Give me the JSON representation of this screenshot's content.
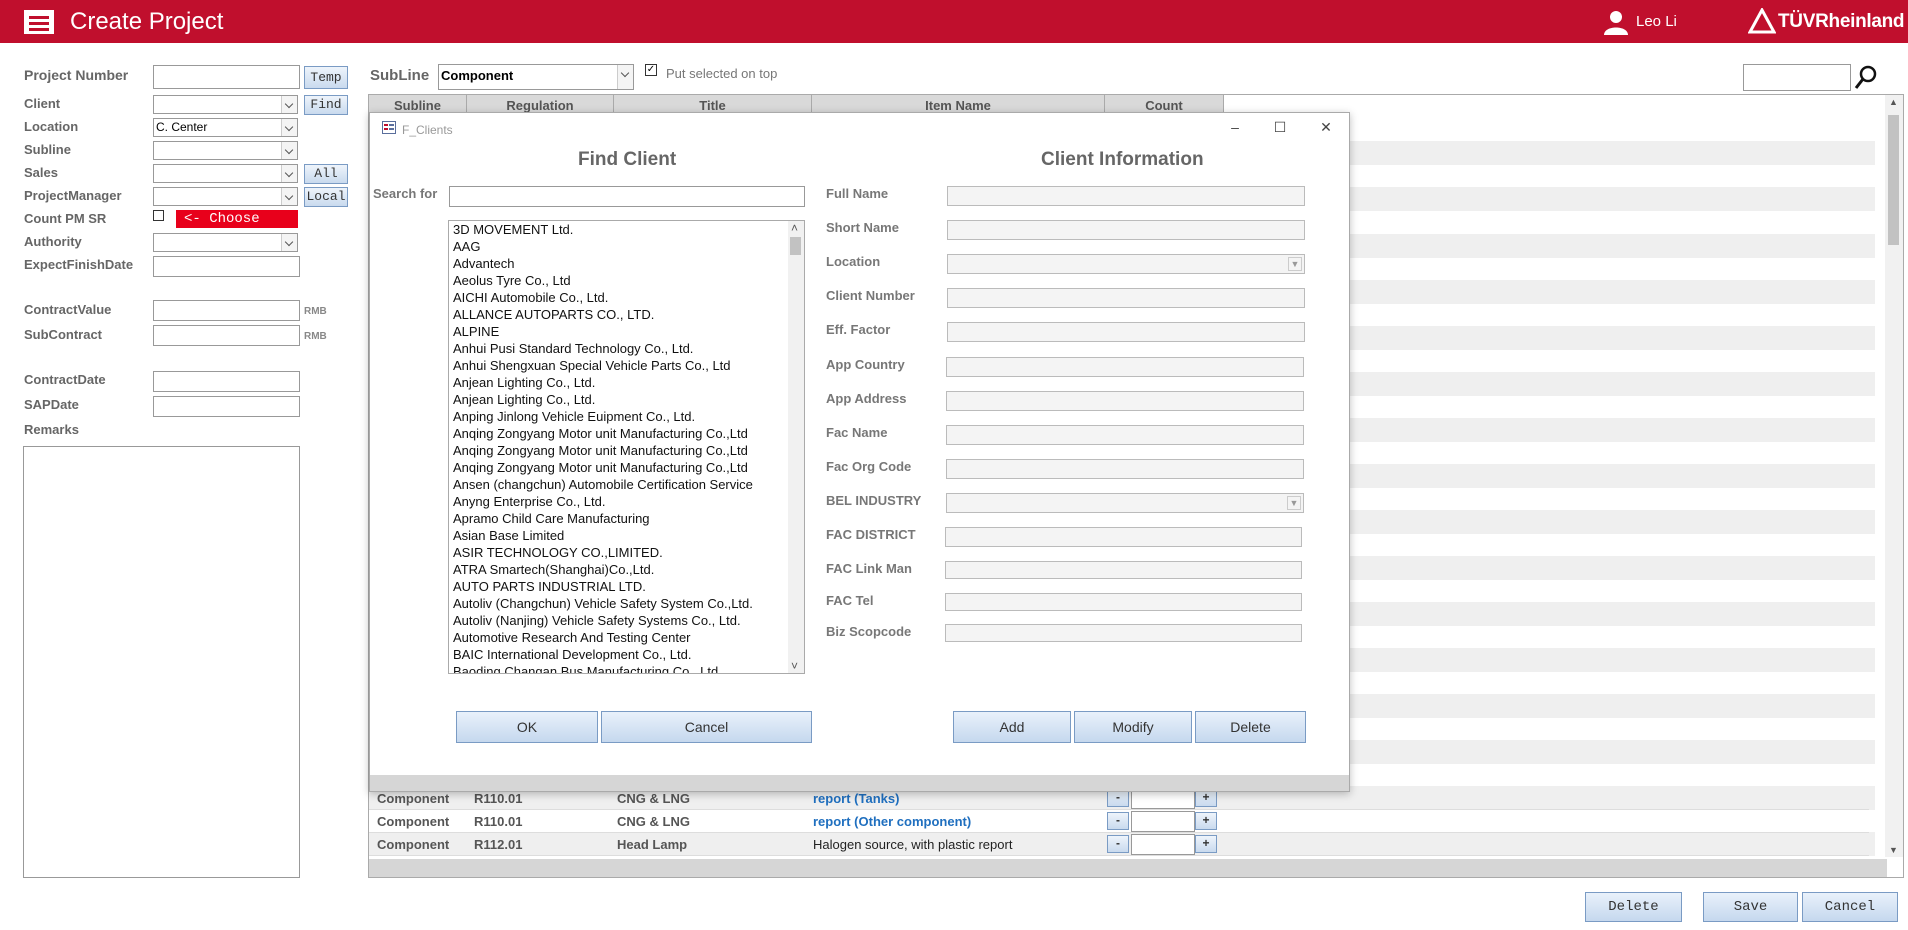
{
  "header": {
    "title": "Create Project",
    "user_name": "Leo Li",
    "brand": "TÜVRheinland",
    "brand_color": "#c00f2d"
  },
  "form": {
    "project_number_label": "Project Number",
    "temp_button": "Temp",
    "client_label": "Client",
    "find_button": "Find",
    "location_label": "Location",
    "location_value": "C. Center",
    "subline_label": "Subline",
    "sales_label": "Sales",
    "all_button": "All",
    "pm_label": "ProjectManager",
    "local_button": "Local",
    "count_pm_sr_label": "Count PM SR",
    "choose_tag": "<- Choose",
    "authority_label": "Authority",
    "expect_finish_label": "ExpectFinishDate",
    "contract_value_label": "ContractValue",
    "rmb_1": "RMB",
    "subcontract_label": "SubContract",
    "rmb_2": "RMB",
    "contract_date_label": "ContractDate",
    "sap_date_label": "SAPDate",
    "remarks_label": "Remarks"
  },
  "toolbar": {
    "subline_label": "SubLine",
    "subline_value": "Component",
    "put_on_top_label": "Put selected on top",
    "put_on_top_checked": true,
    "search_icon": "search-icon"
  },
  "grid": {
    "columns": [
      "Subline",
      "Regulation",
      "Title",
      "Item Name",
      "Count"
    ],
    "rows": [
      {
        "subline": "Component",
        "regulation": "R110.01",
        "title": "CNG & LNG",
        "item": "report (Tanks)",
        "item_color": "#1f6fbf"
      },
      {
        "subline": "Component",
        "regulation": "R110.01",
        "title": "CNG & LNG",
        "item": "report (Other component)",
        "item_color": "#1f6fbf"
      },
      {
        "subline": "Component",
        "regulation": "R112.01",
        "title": "Head Lamp",
        "item": "Halogen source, with plastic report",
        "item_color": "#222222"
      }
    ],
    "minus": "-",
    "plus": "+"
  },
  "dialog": {
    "window_title": "F_Clients",
    "find_heading": "Find Client",
    "info_heading": "Client Information",
    "search_for_label": "Search for",
    "clients": [
      "3D MOVEMENT Ltd.",
      "AAG",
      "Advantech",
      "Aeolus Tyre Co., Ltd",
      "AICHI Automobile Co., Ltd.",
      "ALLANCE AUTOPARTS CO., LTD.",
      "ALPINE",
      "Anhui Pusi Standard Technology Co., Ltd.",
      "Anhui Shengxuan Special Vehicle Parts Co., Ltd",
      "Anjean Lighting Co., Ltd.",
      "Anjean Lighting Co., Ltd.",
      "Anping Jinlong Vehicle Euipment Co., Ltd.",
      "Anqing Zongyang Motor unit Manufacturing Co.,Ltd",
      "Anqing Zongyang Motor unit Manufacturing Co.,Ltd",
      "Anqing Zongyang Motor unit Manufacturing Co.,Ltd",
      "Ansen (changchun) Automobile Certification Service",
      "Anyng Enterprise Co., Ltd.",
      "Apramo Child Care Manufacturing",
      "Asian Base Limited",
      "ASIR TECHNOLOGY CO.,LIMITED.",
      "ATRA Smartech(Shanghai)Co.,Ltd.",
      "AUTO PARTS INDUSTRIAL LTD.",
      "Autoliv (Changchun) Vehicle Safety System Co.,Ltd.",
      "Autoliv (Nanjing) Vehicle Safety Systems Co., Ltd.",
      "Automotive Research And Testing Center",
      "BAIC International Development Co., Ltd.",
      "Baoding Changan Bus Manufacturing Co., Ltd."
    ],
    "fields": [
      "Full Name",
      "Short Name",
      "Location",
      "Client Number",
      "Eff. Factor",
      "App Country",
      "App Address",
      "Fac Name",
      "Fac Org Code",
      "BEL INDUSTRY",
      "FAC DISTRICT",
      "FAC Link Man",
      "FAC Tel",
      "Biz Scopcode"
    ],
    "ok": "OK",
    "cancel": "Cancel",
    "add": "Add",
    "modify": "Modify",
    "delete": "Delete"
  },
  "footer": {
    "delete": "Delete",
    "save": "Save",
    "cancel": "Cancel"
  }
}
